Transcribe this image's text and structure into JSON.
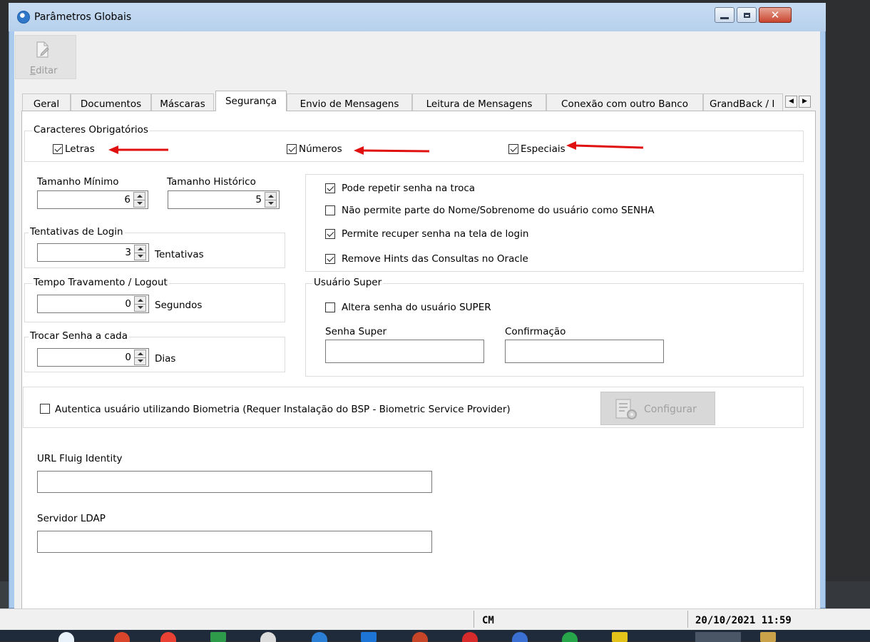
{
  "window": {
    "title": "Parâmetros Globais"
  },
  "toolbar": {
    "edit_label_prefix": "E",
    "edit_label_rest": "ditar"
  },
  "tabs": [
    {
      "label": "Geral"
    },
    {
      "label": "Documentos"
    },
    {
      "label": "Máscaras"
    },
    {
      "label": "Segurança",
      "active": true
    },
    {
      "label": "Envio de Mensagens"
    },
    {
      "label": "Leitura de Mensagens"
    },
    {
      "label": "Conexão com outro Banco"
    },
    {
      "label": "GrandBack / I"
    }
  ],
  "required_chars": {
    "legend": "Caracteres Obrigatórios",
    "letras": {
      "label": "Letras",
      "checked": true
    },
    "numeros": {
      "label": "Números",
      "checked": true
    },
    "especiais": {
      "label": "Especiais",
      "checked": true
    }
  },
  "tamanho_minimo": {
    "label": "Tamanho Mínimo",
    "value": "6"
  },
  "tamanho_historico": {
    "label": "Tamanho Histórico",
    "value": "5"
  },
  "tentativas_login": {
    "legend": "Tentativas de Login",
    "value": "3",
    "unit": "Tentativas"
  },
  "tempo_travamento": {
    "legend": "Tempo Travamento / Logout",
    "value": "0",
    "unit": "Segundos"
  },
  "trocar_senha": {
    "legend": "Trocar Senha a cada",
    "value": "0",
    "unit": "Dias"
  },
  "options": [
    {
      "label": "Pode repetir senha na troca",
      "checked": true
    },
    {
      "label": "Não permite parte do Nome/Sobrenome do usuário como SENHA",
      "checked": false
    },
    {
      "label": "Permite recuper senha na tela de login",
      "checked": true
    },
    {
      "label": "Remove Hints das Consultas no Oracle",
      "checked": true
    }
  ],
  "usuario_super": {
    "legend": "Usuário Super",
    "altera_label": "Altera senha do usuário SUPER",
    "altera_checked": false,
    "senha_label": "Senha Super",
    "confirmacao_label": "Confirmação"
  },
  "biometria": {
    "label": "Autentica usuário utilizando Biometria (Requer Instalação do BSP - Biometric Service Provider)",
    "checked": false,
    "configurar_label": "Configurar"
  },
  "fluig": {
    "label": "URL Fluig Identity",
    "value": ""
  },
  "ldap": {
    "label": "Servidor LDAP",
    "value": ""
  },
  "statusbar": {
    "company": "CM",
    "datetime": "20/10/2021 11:59"
  },
  "colors": {
    "title_bar": "#b6d0ec",
    "close_button": "#c9452e",
    "annotation_arrow": "#e01010"
  }
}
